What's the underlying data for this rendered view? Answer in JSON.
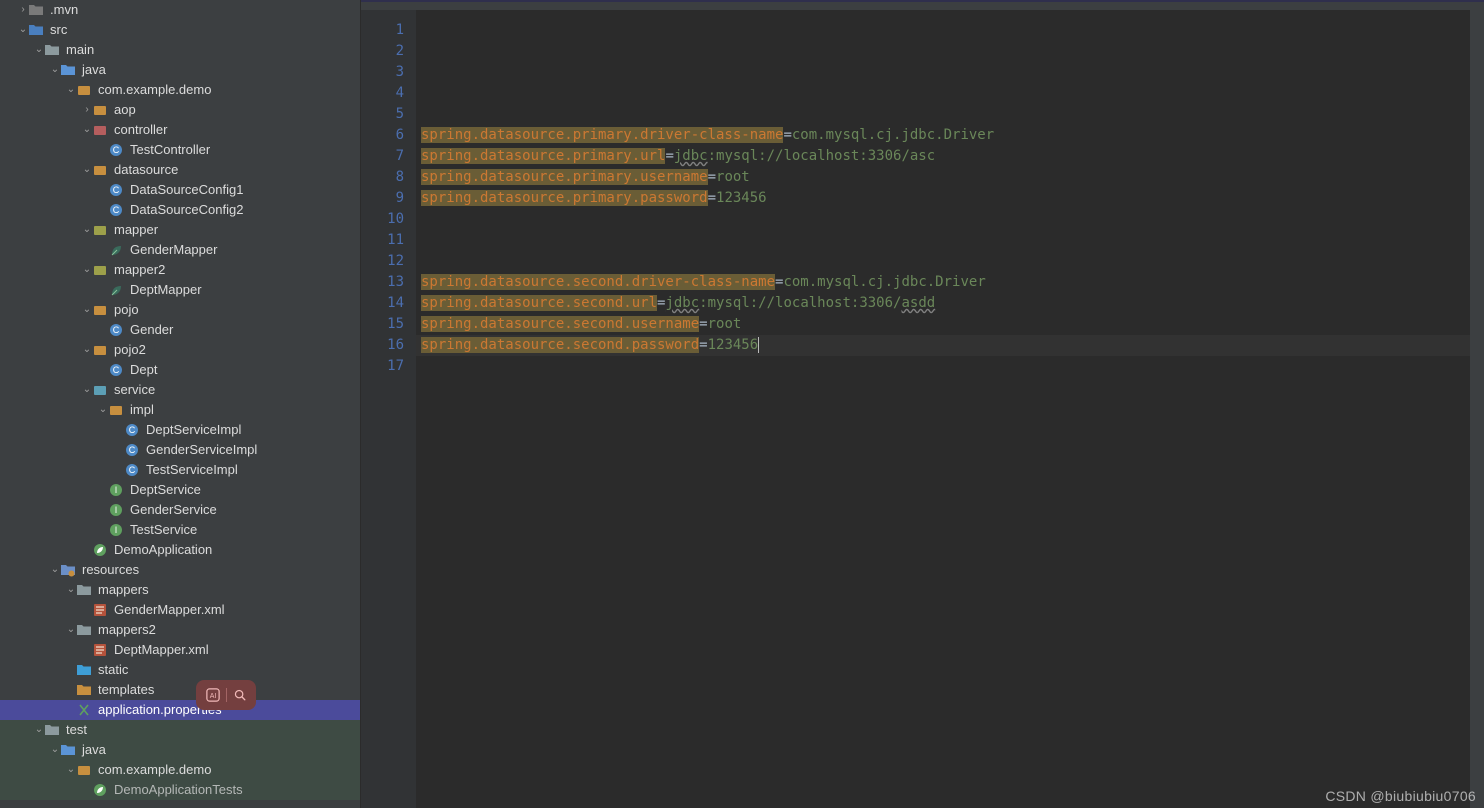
{
  "watermark": "CSDN @biubiubiu0706",
  "tree": [
    {
      "depth": 1,
      "chev": "right",
      "icon": "folder-dark",
      "label": ".mvn"
    },
    {
      "depth": 1,
      "chev": "down",
      "icon": "folder-src",
      "label": "src"
    },
    {
      "depth": 2,
      "chev": "down",
      "icon": "folder",
      "label": "main"
    },
    {
      "depth": 3,
      "chev": "down",
      "icon": "folder-java",
      "label": "java"
    },
    {
      "depth": 4,
      "chev": "down",
      "icon": "package",
      "label": "com.example.demo"
    },
    {
      "depth": 5,
      "chev": "right",
      "icon": "package",
      "label": "aop"
    },
    {
      "depth": 5,
      "chev": "down",
      "icon": "package-ctrl",
      "label": "controller"
    },
    {
      "depth": 6,
      "chev": "",
      "icon": "class",
      "label": "TestController"
    },
    {
      "depth": 5,
      "chev": "down",
      "icon": "package",
      "label": "datasource"
    },
    {
      "depth": 6,
      "chev": "",
      "icon": "class",
      "label": "DataSourceConfig1"
    },
    {
      "depth": 6,
      "chev": "",
      "icon": "class",
      "label": "DataSourceConfig2"
    },
    {
      "depth": 5,
      "chev": "down",
      "icon": "package-y",
      "label": "mapper"
    },
    {
      "depth": 6,
      "chev": "",
      "icon": "leaf",
      "label": "GenderMapper"
    },
    {
      "depth": 5,
      "chev": "down",
      "icon": "package-y",
      "label": "mapper2"
    },
    {
      "depth": 6,
      "chev": "",
      "icon": "leaf",
      "label": "DeptMapper"
    },
    {
      "depth": 5,
      "chev": "down",
      "icon": "package",
      "label": "pojo"
    },
    {
      "depth": 6,
      "chev": "",
      "icon": "class",
      "label": "Gender"
    },
    {
      "depth": 5,
      "chev": "down",
      "icon": "package",
      "label": "pojo2"
    },
    {
      "depth": 6,
      "chev": "",
      "icon": "class",
      "label": "Dept"
    },
    {
      "depth": 5,
      "chev": "down",
      "icon": "package-s",
      "label": "service"
    },
    {
      "depth": 6,
      "chev": "down",
      "icon": "package",
      "label": "impl"
    },
    {
      "depth": 7,
      "chev": "",
      "icon": "class",
      "label": "DeptServiceImpl"
    },
    {
      "depth": 7,
      "chev": "",
      "icon": "class",
      "label": "GenderServiceImpl"
    },
    {
      "depth": 7,
      "chev": "",
      "icon": "class",
      "label": "TestServiceImpl"
    },
    {
      "depth": 6,
      "chev": "",
      "icon": "interface",
      "label": "DeptService"
    },
    {
      "depth": 6,
      "chev": "",
      "icon": "interface",
      "label": "GenderService"
    },
    {
      "depth": 6,
      "chev": "",
      "icon": "interface",
      "label": "TestService"
    },
    {
      "depth": 5,
      "chev": "",
      "icon": "spring",
      "label": "DemoApplication"
    },
    {
      "depth": 3,
      "chev": "down",
      "icon": "folder-res",
      "label": "resources"
    },
    {
      "depth": 4,
      "chev": "down",
      "icon": "folder",
      "label": "mappers"
    },
    {
      "depth": 5,
      "chev": "",
      "icon": "xml",
      "label": "GenderMapper.xml"
    },
    {
      "depth": 4,
      "chev": "down",
      "icon": "folder",
      "label": "mappers2"
    },
    {
      "depth": 5,
      "chev": "",
      "icon": "xml",
      "label": "DeptMapper.xml"
    },
    {
      "depth": 4,
      "chev": "",
      "icon": "folder-static",
      "label": "static"
    },
    {
      "depth": 4,
      "chev": "",
      "icon": "folder-tmpl",
      "label": "templates"
    },
    {
      "depth": 4,
      "chev": "",
      "icon": "props",
      "label": "application.properties",
      "selected": true
    },
    {
      "depth": 2,
      "chev": "down",
      "icon": "folder",
      "label": "test",
      "testbg": true
    },
    {
      "depth": 3,
      "chev": "down",
      "icon": "folder-java",
      "label": "java",
      "testbg": true
    },
    {
      "depth": 4,
      "chev": "down",
      "icon": "package",
      "label": "com.example.demo",
      "testbg": true
    },
    {
      "depth": 5,
      "chev": "",
      "icon": "spring",
      "label": "DemoApplicationTests",
      "testbg": true,
      "dim": true
    }
  ],
  "gutter_lines": 17,
  "code": [
    {
      "n": 1,
      "key": "",
      "val": ""
    },
    {
      "n": 2,
      "key": "",
      "val": ""
    },
    {
      "n": 3,
      "key": "",
      "val": ""
    },
    {
      "n": 4,
      "key": "",
      "val": ""
    },
    {
      "n": 5,
      "key": "",
      "val": ""
    },
    {
      "n": 6,
      "key": "spring.datasource.primary.driver-class-name",
      "val": "com.mysql.cj.jdbc.Driver"
    },
    {
      "n": 7,
      "key": "spring.datasource.primary.url",
      "val": "jdbc:mysql://localhost:3306/asc",
      "warn_prefix": "jdbc"
    },
    {
      "n": 8,
      "key": "spring.datasource.primary.username",
      "val": "root"
    },
    {
      "n": 9,
      "key": "spring.datasource.primary.password",
      "val": "123456"
    },
    {
      "n": 10,
      "key": "",
      "val": ""
    },
    {
      "n": 11,
      "key": "",
      "val": ""
    },
    {
      "n": 12,
      "key": "",
      "val": ""
    },
    {
      "n": 13,
      "key": "spring.datasource.second.driver-class-name",
      "val": "com.mysql.cj.jdbc.Driver"
    },
    {
      "n": 14,
      "key": "spring.datasource.second.url",
      "val": "jdbc:mysql://localhost:3306/asdd",
      "warn_prefix": "jdbc",
      "warn_suffix": "asdd"
    },
    {
      "n": 15,
      "key": "spring.datasource.second.username",
      "val": "root"
    },
    {
      "n": 16,
      "key": "spring.datasource.second.password",
      "val": "123456",
      "current": true
    },
    {
      "n": 17,
      "key": "",
      "val": ""
    }
  ]
}
